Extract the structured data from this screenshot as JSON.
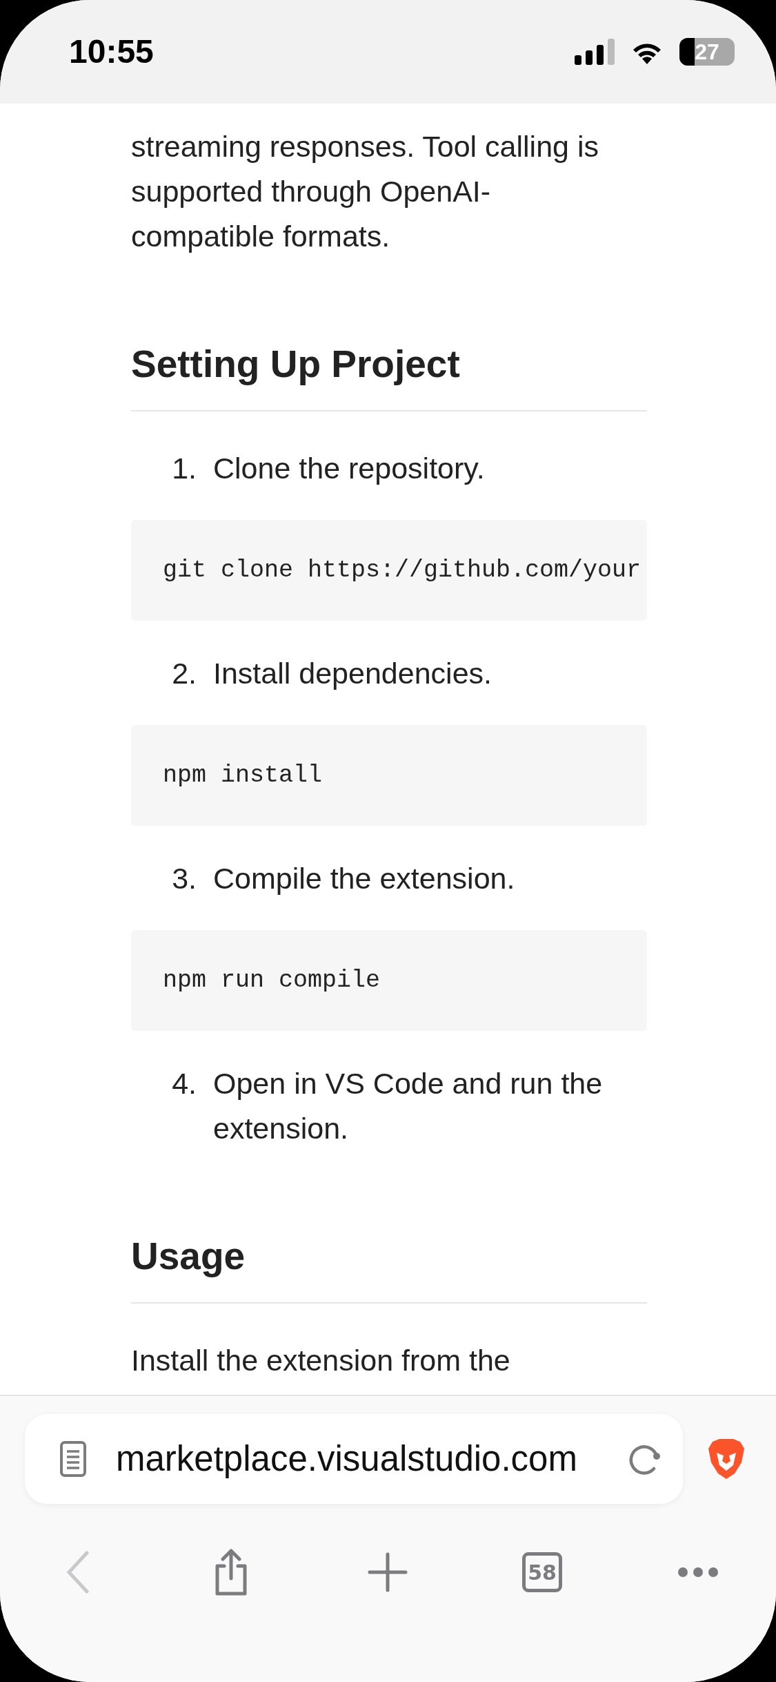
{
  "status_bar": {
    "time": "10:55",
    "battery": "27"
  },
  "content": [
    {
      "kind": "paragraph",
      "text": "streaming responses. Tool calling is supported through OpenAI-compatible formats."
    },
    {
      "kind": "heading",
      "text": "Setting Up Project"
    },
    {
      "kind": "list_item",
      "number": "1.",
      "text": "Clone the repository."
    },
    {
      "kind": "code",
      "text": "git clone https://github.com/your"
    },
    {
      "kind": "list_item",
      "number": "2.",
      "text": "Install dependencies."
    },
    {
      "kind": "code",
      "text": "npm install"
    },
    {
      "kind": "list_item",
      "number": "3.",
      "text": "Compile the extension."
    },
    {
      "kind": "code",
      "text": "npm run compile"
    },
    {
      "kind": "list_item",
      "number": "4.",
      "text": "Open in VS Code and run the extension."
    },
    {
      "kind": "heading",
      "text": "Usage"
    },
    {
      "kind": "paragraph",
      "text": "Install the extension from the"
    }
  ],
  "address_bar": {
    "url": "marketplace.visualstudio.com"
  },
  "toolbar": [
    {
      "kind": "back",
      "disabled": true
    },
    {
      "kind": "share",
      "disabled": false
    },
    {
      "kind": "new_tab",
      "disabled": false
    },
    {
      "kind": "tabs",
      "label": "58",
      "disabled": false
    },
    {
      "kind": "more",
      "disabled": false
    }
  ]
}
